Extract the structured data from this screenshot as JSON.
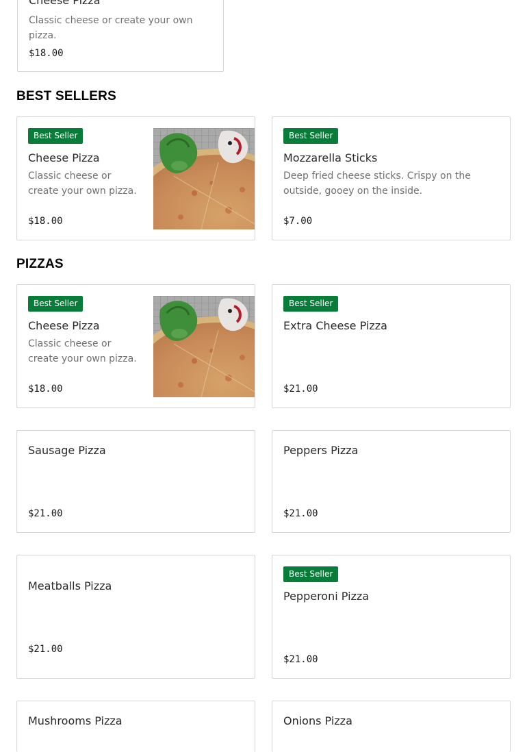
{
  "top_card": {
    "name": "Cheese Pizza",
    "description": "Classic cheese or create your own pizza.",
    "price": "$18.00"
  },
  "best_sellers": {
    "title": "BEST SELLERS",
    "items": [
      {
        "badge": "Best Seller",
        "name": "Cheese Pizza",
        "description": "Classic cheese or create your own pizza.",
        "price": "$18.00"
      },
      {
        "badge": "Best Seller",
        "name": "Mozzarella Sticks",
        "description": "Deep fried cheese sticks. Crispy on the outside, gooey on the inside.",
        "price": "$7.00"
      }
    ]
  },
  "pizzas": {
    "title": "PIZZAS",
    "items": [
      {
        "badge": "Best Seller",
        "name": "Cheese Pizza",
        "description": "Classic cheese or create your own pizza.",
        "price": "$18.00"
      },
      {
        "badge": "Best Seller",
        "name": "Extra Cheese Pizza",
        "price": "$21.00"
      },
      {
        "name": "Sausage Pizza",
        "price": "$21.00"
      },
      {
        "name": "Peppers Pizza",
        "price": "$21.00"
      },
      {
        "name": "Meatballs Pizza",
        "price": "$21.00"
      },
      {
        "badge": "Best Seller",
        "name": "Pepperoni Pizza",
        "price": "$21.00"
      },
      {
        "name": "Mushrooms Pizza"
      },
      {
        "name": "Onions Pizza"
      }
    ]
  },
  "colors": {
    "badge_bg": "#087d3a",
    "card_border": "#d4d4d4",
    "text": "#191919",
    "muted_text": "#6f6f6f"
  }
}
